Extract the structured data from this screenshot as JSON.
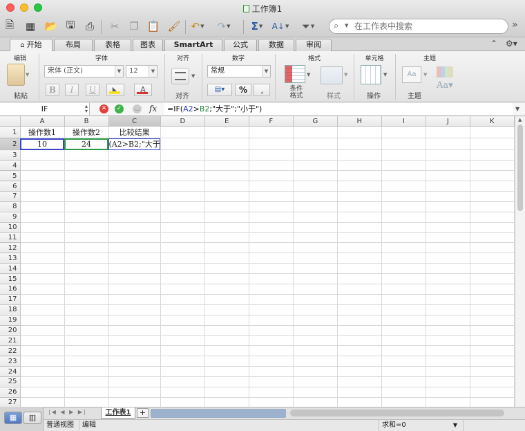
{
  "window": {
    "title": "工作簿1"
  },
  "toolbar": {
    "search_placeholder": "在工作表中搜索",
    "icons": [
      "new-icon",
      "template-icon",
      "open-icon",
      "save-icon",
      "print-icon",
      "cut-icon",
      "copy-icon",
      "paste-icon",
      "format-painter-icon",
      "undo-icon",
      "redo-icon",
      "autosum-icon",
      "sort-icon",
      "filter-icon",
      "search-icon",
      "toolbar-overflow-icon"
    ]
  },
  "ribbon": {
    "tabs": [
      "开始",
      "布局",
      "表格",
      "图表",
      "SmartArt",
      "公式",
      "数据",
      "审阅"
    ],
    "active_tab": "开始",
    "groups": {
      "edit": {
        "title": "编辑",
        "paste_label": "粘贴"
      },
      "font": {
        "title": "字体",
        "font_name": "宋体 (正文)",
        "font_size": "12",
        "bold": "B",
        "italic": "I",
        "underline": "U"
      },
      "align": {
        "title": "对齐",
        "label": "对齐"
      },
      "number": {
        "title": "数字",
        "format": "常规",
        "percent": "%"
      },
      "format": {
        "title": "格式",
        "cond_label": "条件\n格式",
        "style_label": "样式"
      },
      "cells": {
        "title": "单元格",
        "label": "操作"
      },
      "theme": {
        "title": "主题",
        "label": "主题"
      }
    },
    "colors": {
      "fill": "#f3e22c",
      "font": "#d9322f"
    }
  },
  "formula_bar": {
    "name_box": "IF",
    "fx": "fx",
    "formula_prefix": "=IF(",
    "ref1": "A2",
    "op": ">",
    "ref2": "B2",
    "formula_suffix": ";\"大于\";\"小于\")"
  },
  "sheet": {
    "columns": [
      "A",
      "B",
      "C",
      "D",
      "E",
      "F",
      "G",
      "H",
      "I",
      "J",
      "K"
    ],
    "rows": [
      [
        "操作数1",
        "操作数2",
        "比较结果",
        "",
        "",
        "",
        "",
        "",
        "",
        "",
        ""
      ],
      [
        "10",
        "24",
        "(A2>B2;\"大于",
        "",
        "",
        "",
        "",
        "",
        "",
        "",
        ""
      ]
    ],
    "row_count": 27
  },
  "sheet_tabs": {
    "active": "工作表1",
    "add": "+"
  },
  "status_bar": {
    "view": "普通视图",
    "mode": "编辑",
    "sum": "求和=0"
  }
}
